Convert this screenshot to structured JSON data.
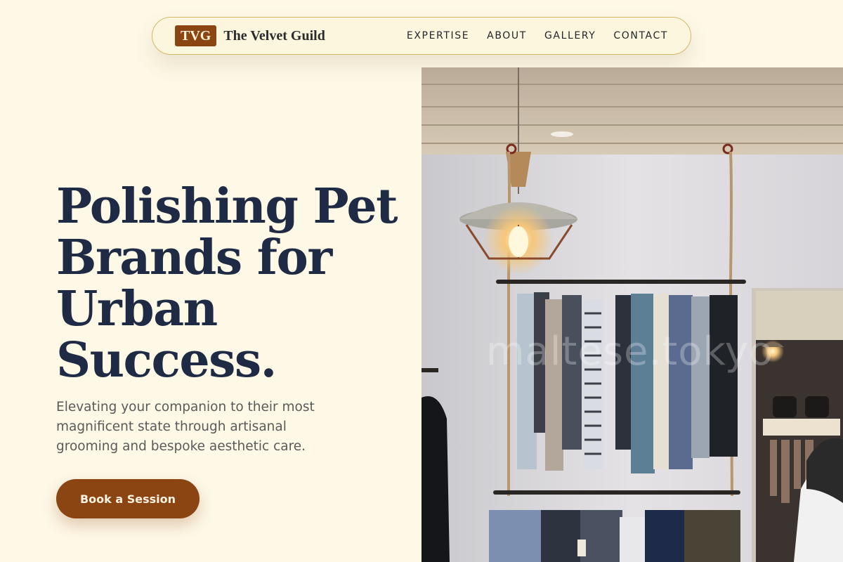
{
  "brand": {
    "badge": "TVG",
    "name": "The Velvet Guild"
  },
  "nav": {
    "items": [
      "EXPERTISE",
      "ABOUT",
      "GALLERY",
      "CONTACT"
    ]
  },
  "hero": {
    "title": "Polishing Pet Brands for Urban Success.",
    "subtitle": "Elevating your companion to their most magnificent state through artisanal grooming and bespoke aesthetic care.",
    "cta_label": "Book a Session",
    "image_watermark": "maltese.tokyo"
  },
  "colors": {
    "background": "#fef8e6",
    "accent": "#8b4513",
    "heading": "#1f2a44",
    "nav_border": "#d4b86a"
  }
}
